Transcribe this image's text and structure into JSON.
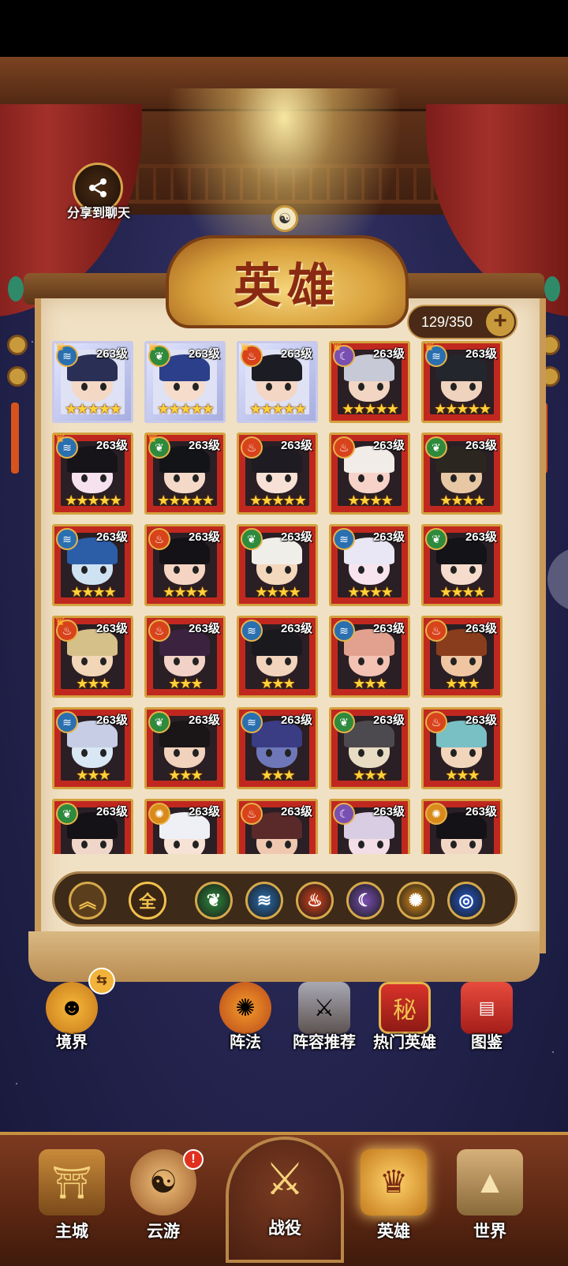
{
  "share": {
    "label": "分享到聊天",
    "icon": "share-icon"
  },
  "panel": {
    "title": "英雄",
    "capacity": "129/350",
    "add_icon": "plus-icon"
  },
  "heroes": [
    {
      "level": "263级",
      "stars": "★★★★★",
      "element": "water",
      "crown": true,
      "frame": "silver",
      "hair": "#2a2f55",
      "skin": "#f4d8c6"
    },
    {
      "level": "263级",
      "stars": "★★★★★",
      "element": "wood",
      "crown": true,
      "frame": "silver",
      "hair": "#2c3f8a",
      "skin": "#f6dccb"
    },
    {
      "level": "263级",
      "stars": "★★★★★",
      "element": "fire",
      "crown": true,
      "frame": "silver",
      "hair": "#1c1c24",
      "skin": "#f4d6c4"
    },
    {
      "level": "263级",
      "stars": "★★★★★",
      "element": "moon",
      "crown": true,
      "frame": "gold",
      "hair": "#c7c9d6",
      "skin": "#f2d5c2"
    },
    {
      "level": "263级",
      "stars": "★★★★★",
      "element": "water",
      "crown": true,
      "frame": "gold",
      "hair": "#24262e",
      "skin": "#f0d3bf"
    },
    {
      "level": "263级",
      "stars": "★★★★★",
      "element": "water",
      "crown": true,
      "frame": "gold",
      "hair": "#161418",
      "skin": "#f6e2ef"
    },
    {
      "level": "263级",
      "stars": "★★★★★",
      "element": "wood",
      "crown": true,
      "frame": "gold",
      "hair": "#121418",
      "skin": "#f5d9c8"
    },
    {
      "level": "263级",
      "stars": "★★★★★",
      "element": "fire",
      "crown": false,
      "frame": "gold",
      "hair": "#1e1b22",
      "skin": "#f7e1d6"
    },
    {
      "level": "263级",
      "stars": "★★★★",
      "element": "fire",
      "crown": false,
      "frame": "gold",
      "hair": "#f2ece8",
      "skin": "#f6d2c8"
    },
    {
      "level": "263级",
      "stars": "★★★★",
      "element": "wood",
      "crown": false,
      "frame": "gold",
      "hair": "#2b2720",
      "skin": "#e8c7a4"
    },
    {
      "level": "263级",
      "stars": "★★★★",
      "element": "water",
      "crown": false,
      "frame": "gold",
      "hair": "#2c5ea8",
      "skin": "#cfe2f2"
    },
    {
      "level": "263级",
      "stars": "★★★★",
      "element": "fire",
      "crown": false,
      "frame": "gold",
      "hair": "#141216",
      "skin": "#f5d4c4"
    },
    {
      "level": "263级",
      "stars": "★★★★",
      "element": "wood",
      "crown": false,
      "frame": "gold",
      "hair": "#f0eee8",
      "skin": "#f4d8bc"
    },
    {
      "level": "263级",
      "stars": "★★★★",
      "element": "water",
      "crown": false,
      "frame": "gold",
      "hair": "#e9e7f5",
      "skin": "#f7e4ee"
    },
    {
      "level": "263级",
      "stars": "★★★★",
      "element": "wood",
      "crown": false,
      "frame": "gold",
      "hair": "#131318",
      "skin": "#f6dccc"
    },
    {
      "level": "263级",
      "stars": "★★★",
      "element": "fire",
      "crown": true,
      "frame": "gold",
      "hair": "#d6c08a",
      "skin": "#f2d6b8"
    },
    {
      "level": "263级",
      "stars": "★★★",
      "element": "fire",
      "crown": false,
      "frame": "gold",
      "hair": "#3b2340",
      "skin": "#f2d2c6"
    },
    {
      "level": "263级",
      "stars": "★★★",
      "element": "water",
      "crown": false,
      "frame": "gold",
      "hair": "#1a1a1e",
      "skin": "#f2d4bd"
    },
    {
      "level": "263级",
      "stars": "★★★",
      "element": "water",
      "crown": false,
      "frame": "gold",
      "hair": "#e2a18e",
      "skin": "#f3c2b2"
    },
    {
      "level": "263级",
      "stars": "★★★",
      "element": "fire",
      "crown": false,
      "frame": "gold",
      "hair": "#8a3d1c",
      "skin": "#f0c6a2"
    },
    {
      "level": "263级",
      "stars": "★★★",
      "element": "water",
      "crown": false,
      "frame": "gold",
      "hair": "#c6cde4",
      "skin": "#d9e6f4"
    },
    {
      "level": "263级",
      "stars": "★★★",
      "element": "wood",
      "crown": false,
      "frame": "gold",
      "hair": "#1a1618",
      "skin": "#f1d2bc"
    },
    {
      "level": "263级",
      "stars": "★★★",
      "element": "water",
      "crown": false,
      "frame": "gold",
      "hair": "#3a3c84",
      "skin": "#6e78b8"
    },
    {
      "level": "263级",
      "stars": "★★★",
      "element": "wood",
      "crown": false,
      "frame": "gold",
      "hair": "#4c4a4e",
      "skin": "#e8dcc4"
    },
    {
      "level": "263级",
      "stars": "★★★",
      "element": "fire",
      "crown": false,
      "frame": "gold",
      "hair": "#78c0c4",
      "skin": "#f2d6bc"
    },
    {
      "level": "263级",
      "stars": "",
      "element": "wood",
      "crown": false,
      "frame": "gold",
      "hair": "#141216",
      "skin": "#f0d6c8"
    },
    {
      "level": "263级",
      "stars": "",
      "element": "sun",
      "crown": false,
      "frame": "gold",
      "hair": "#eef0f6",
      "skin": "#f7e2d6"
    },
    {
      "level": "263级",
      "stars": "",
      "element": "fire",
      "crown": false,
      "frame": "gold",
      "hair": "#5a2a2a",
      "skin": "#f0c8b0"
    },
    {
      "level": "263级",
      "stars": "",
      "element": "moon",
      "crown": false,
      "frame": "gold",
      "hair": "#d8cde2",
      "skin": "#f3dde6"
    },
    {
      "level": "263级",
      "stars": "",
      "element": "sun",
      "crown": false,
      "frame": "gold",
      "hair": "#141216",
      "skin": "#f2d6c4"
    }
  ],
  "filters": {
    "collapse_icon": "double-chevron-up-icon",
    "all_label": "全",
    "elements": [
      {
        "name": "wood",
        "icon": "leaf-icon",
        "color": "#2e8a3c",
        "glyph": "❦"
      },
      {
        "name": "water",
        "icon": "wave-icon",
        "color": "#2a6fb0",
        "glyph": "≋"
      },
      {
        "name": "fire",
        "icon": "flame-icon",
        "color": "#d8431b",
        "glyph": "♨"
      },
      {
        "name": "moon",
        "icon": "moon-icon",
        "color": "#7a4fb2",
        "glyph": "☾"
      },
      {
        "name": "sun",
        "icon": "sun-icon",
        "color": "#d98a1a",
        "glyph": "✺"
      },
      {
        "name": "wind",
        "icon": "vortex-icon",
        "color": "#2458c8",
        "glyph": "◎"
      }
    ]
  },
  "functions": {
    "realm": {
      "label": "境界",
      "icon": "realm-icon"
    },
    "formation": {
      "label": "阵法",
      "icon": "formation-icon"
    },
    "lineup": {
      "label": "阵容推荐",
      "icon": "lineup-icon"
    },
    "hot": {
      "label": "热门英雄",
      "icon": "hot-heroes-icon"
    },
    "codex": {
      "label": "图鉴",
      "icon": "codex-book-icon"
    }
  },
  "nav": {
    "city": {
      "label": "主城",
      "icon": "city-gate-icon"
    },
    "travel": {
      "label": "云游",
      "icon": "travel-gourd-icon",
      "badge": "!"
    },
    "battle": {
      "label": "战役",
      "icon": "crossed-swords-icon"
    },
    "hero": {
      "label": "英雄",
      "icon": "hero-helmet-icon"
    },
    "world": {
      "label": "世界",
      "icon": "mountain-icon"
    }
  },
  "colors": {
    "gold_frame": "#d4a23f",
    "card_red": "#c0281f",
    "panel_paper": "#f1e1c4",
    "nav_brown": "#5a2612"
  }
}
